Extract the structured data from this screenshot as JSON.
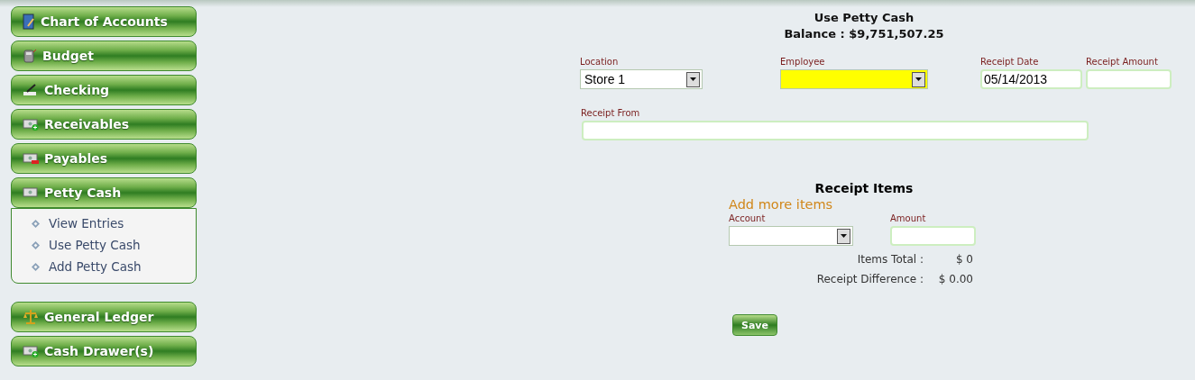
{
  "sidebar": {
    "items": [
      {
        "label": "Chart of Accounts",
        "kind": "book"
      },
      {
        "label": "Budget",
        "kind": "calculator"
      },
      {
        "label": "Checking",
        "kind": "check"
      },
      {
        "label": "Receivables",
        "kind": "money-plus"
      },
      {
        "label": "Payables",
        "kind": "money-minus"
      },
      {
        "label": "Petty Cash",
        "kind": "money",
        "children": [
          {
            "label": "View Entries"
          },
          {
            "label": "Use Petty Cash"
          },
          {
            "label": "Add Petty Cash"
          }
        ]
      },
      {
        "label": "General Ledger",
        "kind": "scale"
      },
      {
        "label": "Cash Drawer(s)",
        "kind": "money-plus"
      }
    ]
  },
  "form": {
    "title": "Use Petty Cash",
    "balance": "Balance : $9,751,507.25",
    "location": {
      "label": "Location",
      "value": "Store 1"
    },
    "employee": {
      "label": "Employee",
      "highlighted": true
    },
    "receipt_date": {
      "label": "Receipt Date",
      "value": "05/14/2013"
    },
    "receipt_amount": {
      "label": "Receipt Amount"
    },
    "receipt_from": {
      "label": "Receipt From"
    }
  },
  "receipt_items": {
    "title": "Receipt Items",
    "add_link": "Add more items",
    "account": {
      "label": "Account"
    },
    "amount": {
      "label": "Amount"
    },
    "totals": [
      {
        "label": "Items Total :",
        "value": "$ 0"
      },
      {
        "label": "Receipt Difference :",
        "value": "$ 0.00"
      }
    ],
    "save": "Save"
  }
}
